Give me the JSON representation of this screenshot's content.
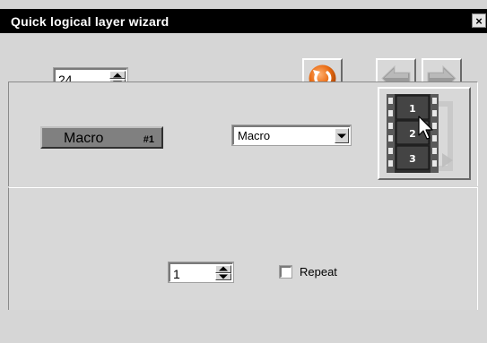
{
  "window": {
    "title": "Quick logical layer wizard",
    "close_glyph": "×"
  },
  "toolbar": {
    "layer_spin_value": "24",
    "icons": [
      "refresh-icon",
      "arrow-left-icon",
      "arrow-right-icon"
    ]
  },
  "macro": {
    "button_label": "Macro",
    "button_number": "#1",
    "type_select_value": "Macro"
  },
  "film_icon": {
    "frames": [
      "1",
      "2",
      "3"
    ]
  },
  "bottom": {
    "count_spin_value": "1",
    "repeat_label": "Repeat",
    "repeat_checked": false
  },
  "colors": {
    "titlebar": "#000000",
    "background": "#d6d6d6",
    "refresh_orange": "#e96c14",
    "arrow_gray": "#9a9a9a"
  }
}
